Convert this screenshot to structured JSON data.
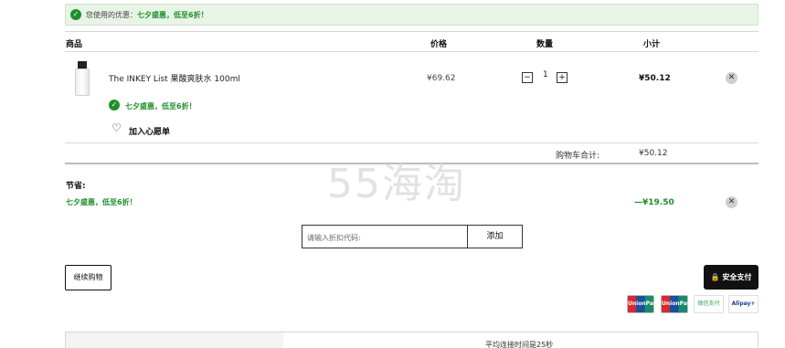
{
  "promo_bar": {
    "label": "您使用的优惠：",
    "name": "七夕盛惠，低至6折！"
  },
  "table_header": {
    "product": "商品",
    "price": "价格",
    "quantity": "数量",
    "subtotal": "小计"
  },
  "item": {
    "name": "The INKEY List 果酸爽肤水 100ml",
    "price": "¥69.62",
    "qty_minus": "−",
    "qty_value": "1",
    "qty_plus": "+",
    "subtotal": "¥50.12",
    "promo": "七夕盛惠，低至6折！",
    "wishlist_label": "加入心愿单"
  },
  "cart_total": {
    "label": "购物车合计:",
    "value": "¥50.12"
  },
  "watermark": "55海淘",
  "savings": {
    "label": "节省:",
    "promo": "七夕盛惠，低至6折！",
    "value": "—¥19.50"
  },
  "coupon": {
    "placeholder": "请输入折扣代码:",
    "add_label": "添加"
  },
  "continue_label": "继续购物",
  "checkout_label": "安全支付",
  "payments": [
    "UnionPay",
    "UnionPay",
    "微信支付",
    "Alipay+"
  ],
  "footer_note": "平均连接时间是25秒",
  "icons": {
    "check": "check-circle-icon",
    "heart": "heart-outline-icon",
    "close": "close-icon",
    "lock": "lock-icon"
  },
  "colors": {
    "accent_green": "#1f8f2c",
    "promo_bg": "#e8f4e6",
    "checkout_bg": "#111111"
  }
}
